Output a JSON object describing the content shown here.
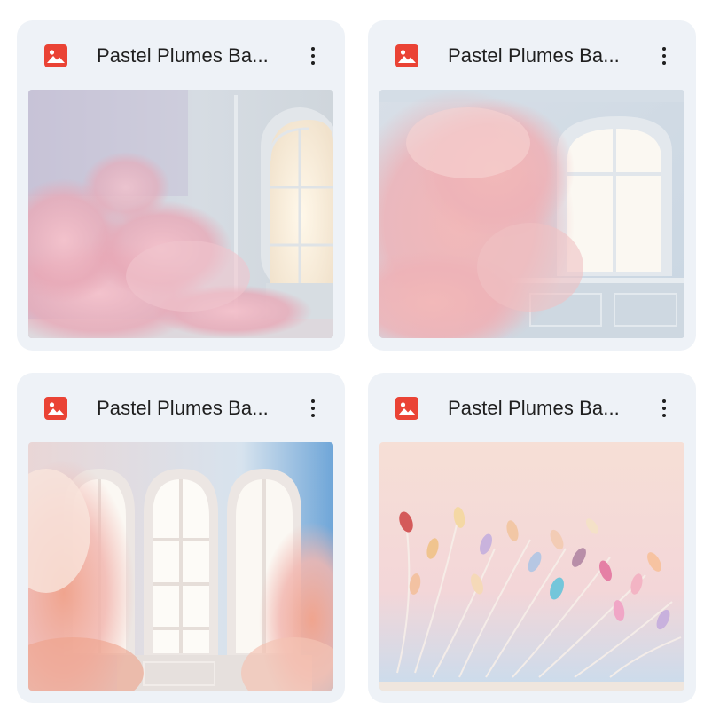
{
  "files": [
    {
      "title": "Pastel Plumes Ba...",
      "type_icon": "image-file-icon",
      "menu_icon": "more-vert-icon"
    },
    {
      "title": "Pastel Plumes Ba...",
      "type_icon": "image-file-icon",
      "menu_icon": "more-vert-icon"
    },
    {
      "title": "Pastel Plumes Ba...",
      "type_icon": "image-file-icon",
      "menu_icon": "more-vert-icon"
    },
    {
      "title": "Pastel Plumes Ba...",
      "type_icon": "image-file-icon",
      "menu_icon": "more-vert-icon"
    }
  ],
  "colors": {
    "card_background": "#eef2f7",
    "icon_red": "#ea4335",
    "text": "#1f1f1f"
  }
}
